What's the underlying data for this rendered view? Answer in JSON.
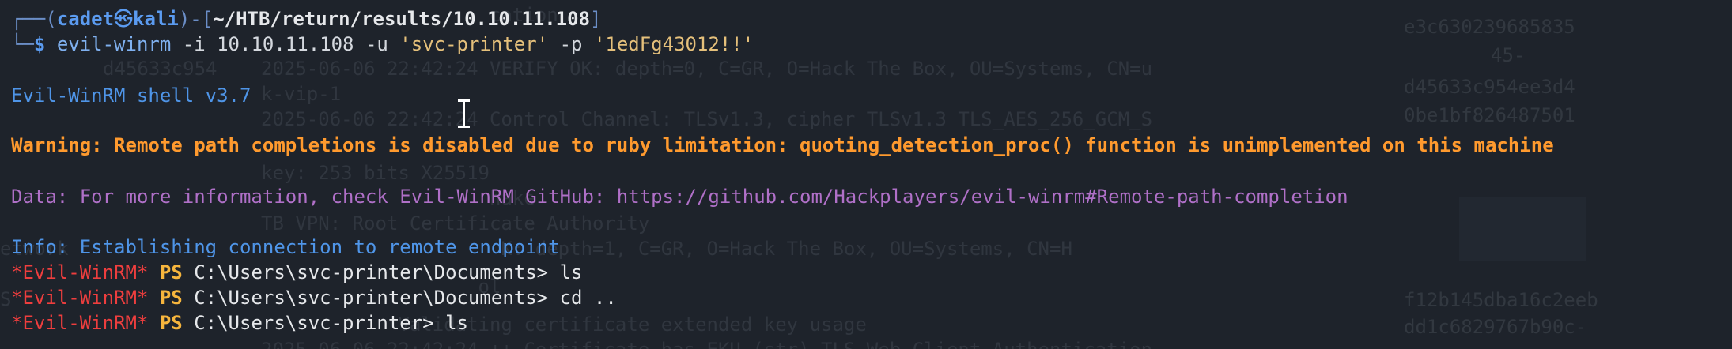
{
  "prompt": {
    "open_paren": "┌──(",
    "user": "cadet",
    "skull": "㉿",
    "host": "kali",
    "close_bracket": ")-[",
    "cwd": "~/HTB/return/results/10.10.11.108",
    "end_bracket": "]",
    "corner": "└─",
    "dollar": "$"
  },
  "command": {
    "binary": "evil-winrm",
    "args_before_user": " -i 10.10.11.108 -u ",
    "user_value": "'svc-printer'",
    "pass_flag": " -p ",
    "pass_value": "'1edFg43012!!'"
  },
  "output": {
    "banner": "Evil-WinRM shell v3.7",
    "warning": "Warning: Remote path completions is disabled due to ruby limitation: quoting_detection_proc() function is unimplemented on this machine",
    "data": "Data: For more information, check Evil-WinRM GitHub: https://github.com/Hackplayers/evil-winrm#Remote-path-completion",
    "info": "Info: Establishing connection to remote endpoint"
  },
  "ps_lines": [
    {
      "tag": "*Evil-WinRM*",
      "ps": "PS",
      "text": "C:\\Users\\svc-printer\\Documents> ls"
    },
    {
      "tag": "*Evil-WinRM*",
      "ps": "PS",
      "text": "C:\\Users\\svc-printer\\Documents> cd .."
    },
    {
      "tag": "*Evil-WinRM*",
      "ps": "PS",
      "text": "C:\\Users\\svc-printer> ls"
    }
  ],
  "colors": {
    "background": "#1e232b",
    "prompt_blue": "#5b9bf0",
    "warning_orange": "#ff9a2e",
    "data_purple": "#b070c8",
    "evil_red": "#ee3e3e",
    "ps_yellow": "#f6b53d"
  }
}
